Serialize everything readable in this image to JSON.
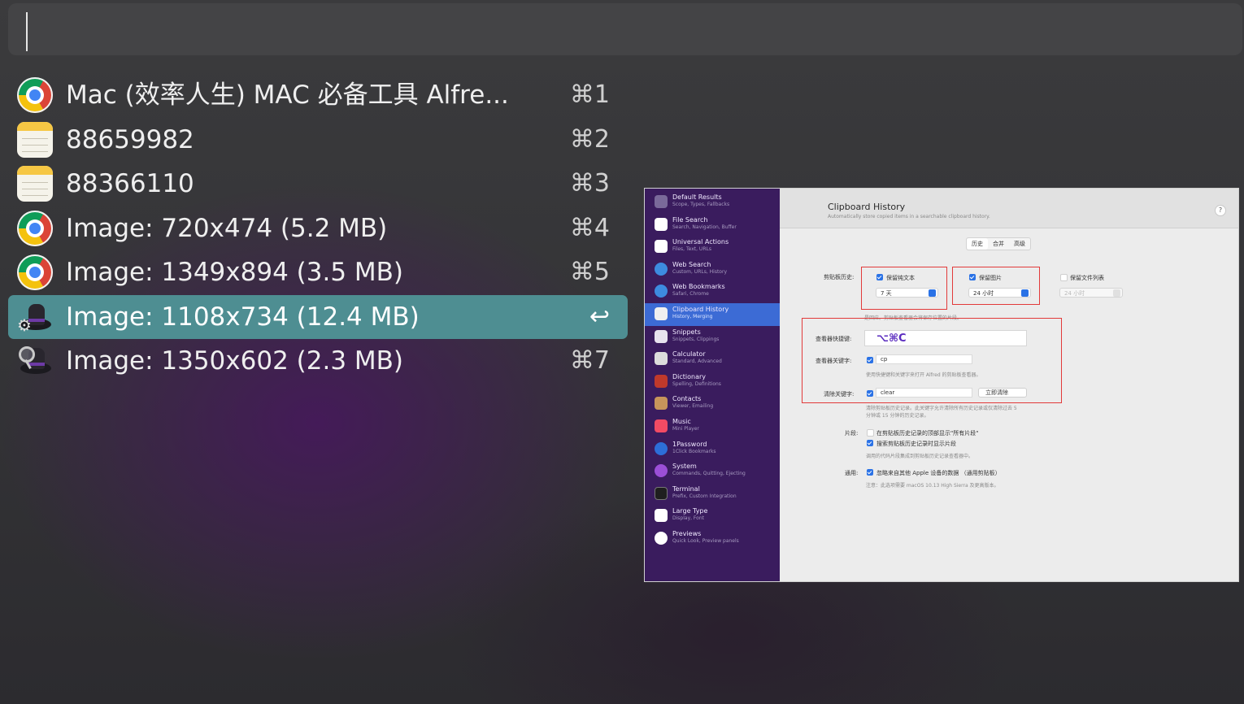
{
  "search": {
    "value": ""
  },
  "results": [
    {
      "title": "Mac (效率人生) MAC 必备工具 Alfre...",
      "shortcut": "⌘1",
      "icon": "chrome-icon"
    },
    {
      "title": "88659982",
      "shortcut": "⌘2",
      "icon": "notes-icon"
    },
    {
      "title": "88366110",
      "shortcut": "⌘3",
      "icon": "notes-icon"
    },
    {
      "title": "Image: 720x474 (5.2 MB)",
      "shortcut": "⌘4",
      "icon": "chrome-icon"
    },
    {
      "title": "Image: 1349x894 (3.5 MB)",
      "shortcut": "⌘5",
      "icon": "chrome-icon"
    },
    {
      "title": "Image: 1108x734 (12.4 MB)",
      "shortcut": "↩",
      "icon": "alfred-preferences-icon",
      "selected": true
    },
    {
      "title": "Image: 1350x602 (2.3 MB)",
      "shortcut": "⌘7",
      "icon": "alfred-icon"
    }
  ],
  "preview": {
    "sidebar": [
      {
        "title": "Default Results",
        "sub": "Scope, Types, Fallbacks",
        "color": "#7a6a9a"
      },
      {
        "title": "File Search",
        "sub": "Search, Navigation, Buffer",
        "color": "#ffffff"
      },
      {
        "title": "Universal Actions",
        "sub": "Files, Text, URLs",
        "color": "#ffffff"
      },
      {
        "title": "Web Search",
        "sub": "Custom, URLs, History",
        "color": "#3d8be0"
      },
      {
        "title": "Web Bookmarks",
        "sub": "Safari, Chrome",
        "color": "#3d8be0"
      },
      {
        "title": "Clipboard History",
        "sub": "History, Merging",
        "color": "#f0f0f0",
        "active": true
      },
      {
        "title": "Snippets",
        "sub": "Snippets, Clippings",
        "color": "#e7e2ee"
      },
      {
        "title": "Calculator",
        "sub": "Standard, Advanced",
        "color": "#dcdcdc"
      },
      {
        "title": "Dictionary",
        "sub": "Spelling, Definitions",
        "color": "#c0392b"
      },
      {
        "title": "Contacts",
        "sub": "Viewer, Emailing",
        "color": "#c7955b"
      },
      {
        "title": "Music",
        "sub": "Mini Player",
        "color": "#f24b64"
      },
      {
        "title": "1Password",
        "sub": "1Click Bookmarks",
        "color": "#2d6ed8"
      },
      {
        "title": "System",
        "sub": "Commands, Quitting, Ejecting",
        "color": "#9b4fd6"
      },
      {
        "title": "Terminal",
        "sub": "Prefix, Custom Integration",
        "color": "#1f1f1f"
      },
      {
        "title": "Large Type",
        "sub": "Display, Font",
        "color": "#ffffff"
      },
      {
        "title": "Previews",
        "sub": "Quick Look, Preview panels",
        "color": "#ffffff"
      }
    ],
    "header": {
      "title": "Clipboard History",
      "subtitle": "Automatically store copied items in a searchable clipboard history.",
      "help": "?"
    },
    "tabs": [
      "历史",
      "合并",
      "高级"
    ],
    "history": {
      "label": "剪贴板历史:",
      "text_label": "保留纯文本",
      "text_value": "7 天",
      "image_label": "保留图片",
      "image_value": "24 小时",
      "files_label": "保留文件列表",
      "files_value": "24 小时",
      "note": "是回应。剪贴板查看器会将保存位置的片段。"
    },
    "viewer": {
      "hotkey_label": "查看器快捷键:",
      "hotkey_value": "⌥⌘C",
      "keyword_label": "查看器关键字:",
      "keyword_value": "cp",
      "keyword_note": "使用快捷键和关键字来打开 Alfred 的剪贴板查看器。",
      "clear_label": "清除关键字:",
      "clear_value": "clear",
      "clear_button": "立即清除",
      "clear_note1": "清除剪贴板历史记录。此关键字允许清除所有历史记录或仅清除过去 5",
      "clear_note2": "分钟或 15 分钟的历史记录。"
    },
    "snippets": {
      "label": "片段:",
      "opt1": "在剪贴板历史记录的顶部显示\"所有片段\"",
      "opt2": "搜索剪贴板历史记录时显示片段",
      "note": "调用的代码片段集成到剪贴板历史记录查看器中。"
    },
    "general": {
      "label": "通用:",
      "opt1": "忽略来自其他 Apple 设备的数据 （通用剪贴板）",
      "note": "注意：此选项需要 macOS 10.13 High Sierra 及更高版本。"
    }
  }
}
